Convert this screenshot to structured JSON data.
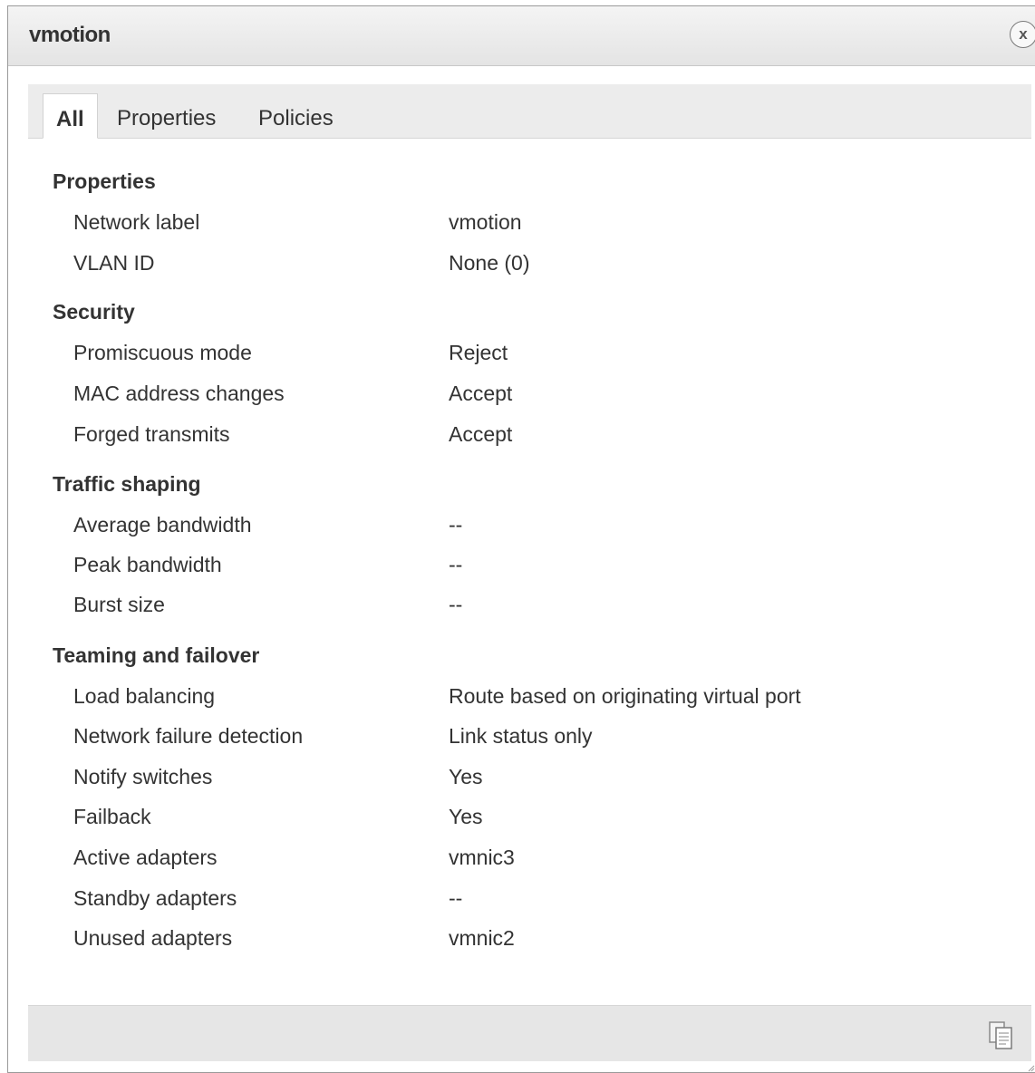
{
  "dialog": {
    "title": "vmotion",
    "close_icon": "close-icon",
    "close_glyph": "x"
  },
  "tabs": [
    {
      "label": "All",
      "active": true
    },
    {
      "label": "Properties",
      "active": false
    },
    {
      "label": "Policies",
      "active": false
    }
  ],
  "sections": [
    {
      "header": "Properties",
      "rows": [
        {
          "label": "Network label",
          "value": "vmotion"
        },
        {
          "label": "VLAN ID",
          "value": "None (0)"
        }
      ]
    },
    {
      "header": "Security",
      "rows": [
        {
          "label": "Promiscuous mode",
          "value": "Reject"
        },
        {
          "label": "MAC address changes",
          "value": "Accept"
        },
        {
          "label": "Forged transmits",
          "value": "Accept"
        }
      ]
    },
    {
      "header": "Traffic shaping",
      "rows": [
        {
          "label": "Average bandwidth",
          "value": "--"
        },
        {
          "label": "Peak bandwidth",
          "value": "--"
        },
        {
          "label": "Burst size",
          "value": "--"
        }
      ]
    },
    {
      "header": "Teaming and failover",
      "rows": [
        {
          "label": "Load balancing",
          "value": "Route based on originating virtual port"
        },
        {
          "label": "Network failure detection",
          "value": "Link status only"
        },
        {
          "label": "Notify switches",
          "value": "Yes"
        },
        {
          "label": "Failback",
          "value": "Yes"
        },
        {
          "label": "Active adapters",
          "value": "vmnic3"
        },
        {
          "label": "Standby adapters",
          "value": "--"
        },
        {
          "label": "Unused adapters",
          "value": "vmnic2"
        }
      ]
    }
  ],
  "footer": {
    "export_icon": "export-copy-icon"
  },
  "colors": {
    "titlebar": "#e8e8e8",
    "tabstrip": "#ececec",
    "footer": "#e6e6e6",
    "text": "#333333"
  }
}
